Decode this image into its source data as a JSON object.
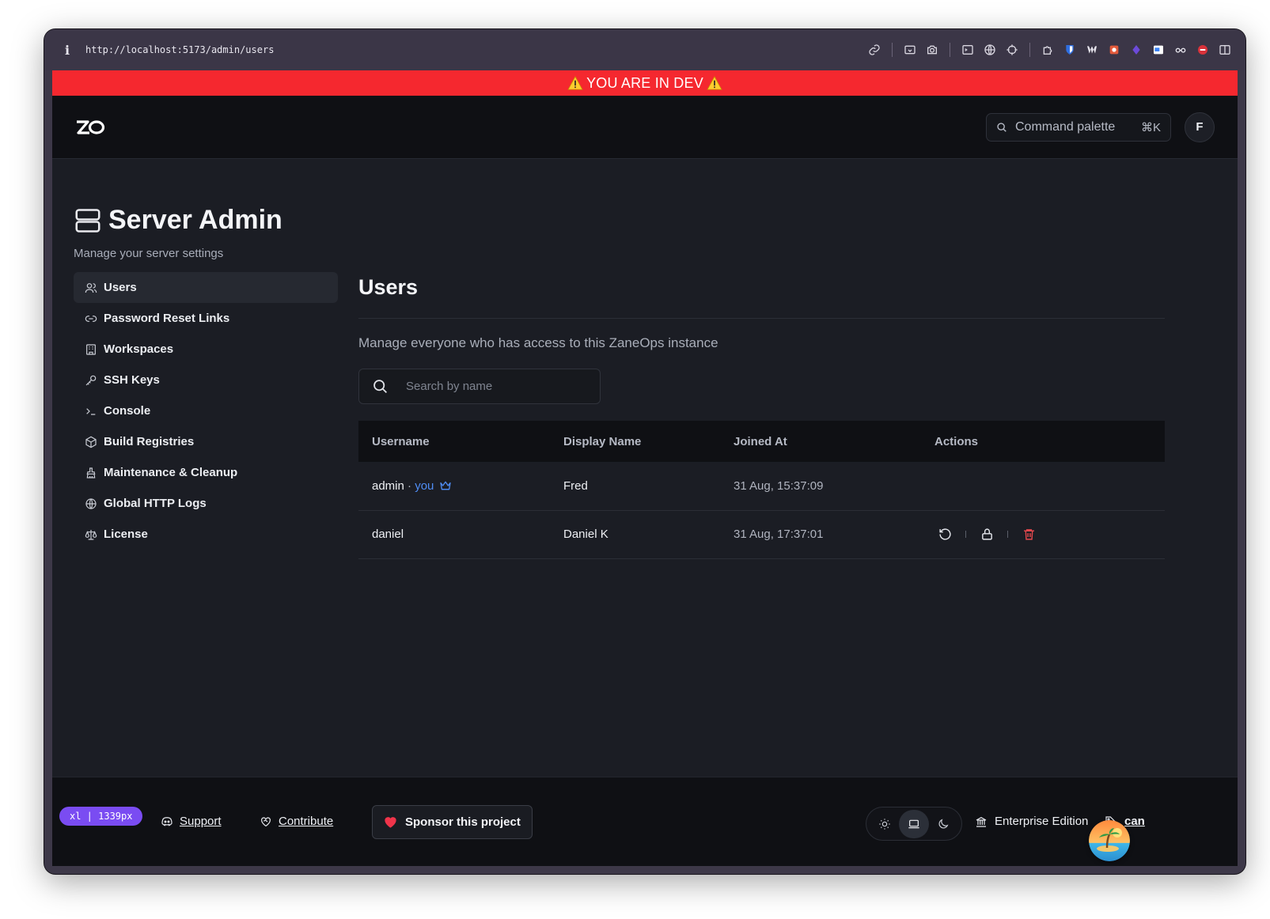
{
  "browser": {
    "info_glyph": "i",
    "url": "http://localhost:5173/admin/users"
  },
  "dev_banner": {
    "text": "YOU ARE IN DEV"
  },
  "header": {
    "command_palette": {
      "label": "Command palette",
      "shortcut": "⌘K"
    },
    "avatar_initial": "F"
  },
  "page": {
    "title": "Server Admin",
    "subtitle": "Manage your server settings"
  },
  "sidebar": {
    "items": [
      {
        "label": "Users",
        "icon": "users-icon",
        "active": true
      },
      {
        "label": "Password Reset Links",
        "icon": "link-icon"
      },
      {
        "label": "Workspaces",
        "icon": "building-icon"
      },
      {
        "label": "SSH Keys",
        "icon": "key-icon"
      },
      {
        "label": "Console",
        "icon": "terminal-icon"
      },
      {
        "label": "Build Registries",
        "icon": "package-icon"
      },
      {
        "label": "Maintenance & Cleanup",
        "icon": "brush-icon"
      },
      {
        "label": "Global HTTP Logs",
        "icon": "globe-icon"
      },
      {
        "label": "License",
        "icon": "scale-icon"
      }
    ]
  },
  "main": {
    "title": "Users",
    "subtitle": "Manage everyone who has access to this ZaneOps instance",
    "search_placeholder": "Search by name",
    "columns": [
      "Username",
      "Display Name",
      "Joined At",
      "Actions"
    ],
    "rows": [
      {
        "username": "admin",
        "separator": "·",
        "you_label": "you",
        "display_name": "Fred",
        "joined_at": "31 Aug, 15:37:09"
      },
      {
        "username": "daniel",
        "display_name": "Daniel K",
        "joined_at": "31 Aug, 17:37:01"
      }
    ]
  },
  "footer": {
    "breakpoint_badge": "xl | 1339px",
    "support_label": "Support",
    "contribute_label": "Contribute",
    "sponsor_label": "Sponsor this project",
    "edition_label": "Enterprise Edition",
    "version_label": "can"
  },
  "colors": {
    "dev_banner": "#f5282f",
    "accent_blue": "#4f8df5",
    "danger": "#e5484d",
    "badge_purple": "#7a4cf2"
  }
}
